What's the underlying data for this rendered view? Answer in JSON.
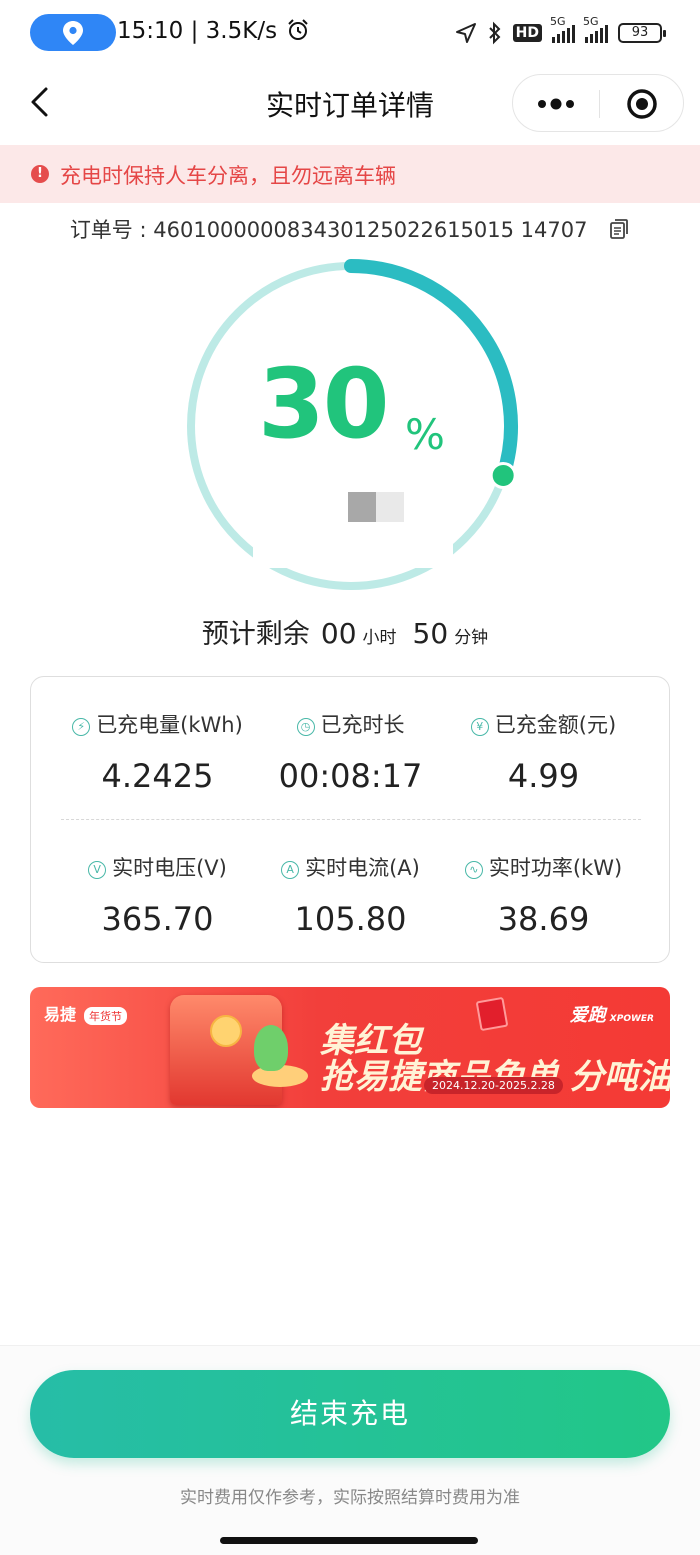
{
  "status_bar": {
    "time_speed": "15:10 | 3.5K/s",
    "battery": "93",
    "hd_label": "HD",
    "network_label": "5G"
  },
  "nav": {
    "title": "实时订单详情"
  },
  "warning": {
    "text": "充电时保持人车分离，且勿远离车辆"
  },
  "order": {
    "label": "订单号 : ",
    "number": "460100000083430125022615015 14707"
  },
  "progress": {
    "percent": 30,
    "percent_text": "30",
    "percent_sign": "%"
  },
  "remaining": {
    "prefix": "预计剩余",
    "hours": "00",
    "hours_unit": "小时",
    "minutes": "50",
    "minutes_unit": "分钟"
  },
  "stats": {
    "energy": {
      "label": "已充电量(kWh)",
      "value": "4.2425",
      "icon": "lightning-icon"
    },
    "duration": {
      "label": "已充时长",
      "value": "00:08:17",
      "icon": "clock-icon"
    },
    "amount": {
      "label": "已充金额(元)",
      "value": "4.99",
      "icon": "yen-icon"
    },
    "voltage": {
      "label": "实时电压(V)",
      "value": "365.70",
      "icon": "voltage-icon"
    },
    "current": {
      "label": "实时电流(A)",
      "value": "105.80",
      "icon": "current-icon"
    },
    "power": {
      "label": "实时功率(kW)",
      "value": "38.69",
      "icon": "wave-icon"
    }
  },
  "ad": {
    "logo": "易捷",
    "logo_tag": "年货节",
    "brand": "爱跑",
    "brand_sub": "XPOWER",
    "line1": "集红包",
    "line2": "抢易捷商品免单 分吨油",
    "date": "2024.12.20-2025.2.28"
  },
  "footer": {
    "button_label": "结束充电",
    "note": "实时费用仅作参考，实际按照结算时费用为准"
  },
  "colors": {
    "accent_green": "#21c47c",
    "ring_teal": "#2bbcc2",
    "ring_track": "#bdeae6",
    "warning_red": "#e54646",
    "warning_bg": "#fce8e8"
  }
}
